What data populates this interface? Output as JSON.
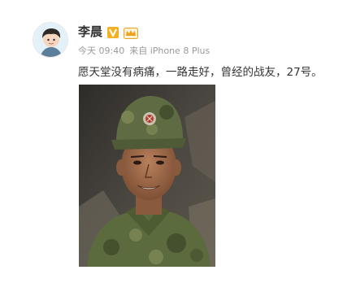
{
  "post": {
    "author": "李晨",
    "time": "今天 09:40",
    "source": "来自 iPhone 8 Plus",
    "text": "愿天堂没有病痛，一路走好，曾经的战友，27号。",
    "avatar_icon": "avatar-portrait-icon",
    "verified_icon": "verified-v-icon",
    "member_icon": "member-crown-icon",
    "image": "photo-soldier-in-camouflage-cap"
  },
  "colors": {
    "name": "#333333",
    "meta": "#999999",
    "text": "#333333",
    "verified": "#f4b021"
  }
}
